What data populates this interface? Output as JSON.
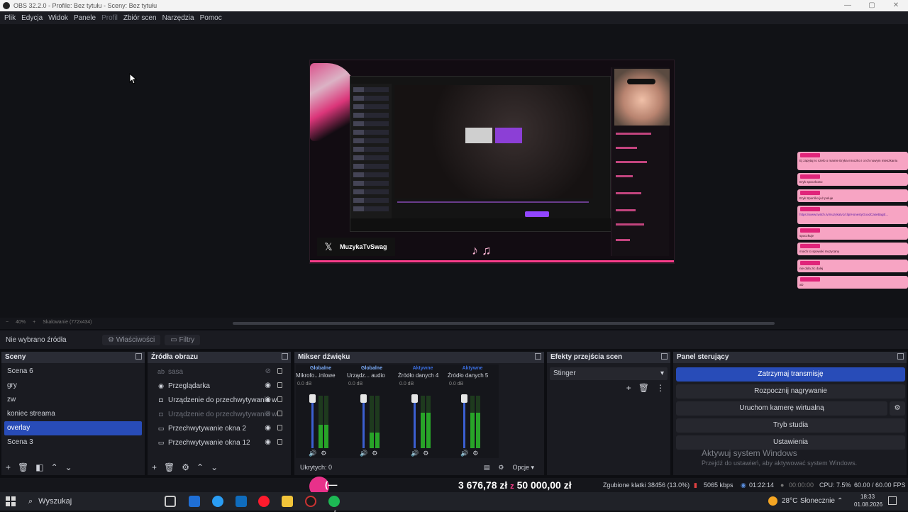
{
  "window": {
    "title": "OBS 32.2.0 - Profile: Bez tytułu - Sceny: Bez tytułu",
    "controls": [
      "—",
      "▢",
      "✕"
    ]
  },
  "menu": [
    "Plik",
    "Edycja",
    "Widok",
    "Panele",
    "Profil",
    "Zbiór scen",
    "Narzędzia",
    "Pomoc"
  ],
  "preview": {
    "stream_name": "MuzykaTvSwag",
    "zoom": "40%",
    "scaling": "Skalowanie (772x434)"
  },
  "chat_overlay": {
    "messages": [
      "Ej zapytaj ro szelo o mamie Eryka mroczko i o ich nowym mieszkaniu",
      "Eryk spoczkowo",
      "Eryk Sporriko już poluje",
      "https://www.twitch.tv/muzykatv1/clip/HonestyGoodCakeBagE...",
      "spoczkuje",
      "moich to spowoki muzycany",
      "nie dola zic dalej",
      "xD"
    ]
  },
  "source_toolbar": {
    "no_source": "Nie wybrano źródła",
    "properties": "Właściwości",
    "filters": "Filtry"
  },
  "scenes": {
    "title": "Sceny",
    "items": [
      "Scena 6",
      "gry",
      "zw",
      "koniec streama",
      "overlay",
      "Scena 3"
    ],
    "selected": "overlay"
  },
  "sources": {
    "title": "Źródła obrazu",
    "items": [
      {
        "label": "sasa",
        "icon": "text-icon",
        "visible": false
      },
      {
        "label": "Przeglądarka",
        "icon": "globe-icon",
        "visible": true
      },
      {
        "label": "Urządzenie do przechwytywania w",
        "icon": "camera-icon",
        "visible": true
      },
      {
        "label": "Urządzenie do przechwytywania w",
        "icon": "camera-icon",
        "visible": false
      },
      {
        "label": "Przechwytywanie okna 2",
        "icon": "window-icon",
        "visible": true
      },
      {
        "label": "Przechwytywanie okna 12",
        "icon": "window-icon",
        "visible": true
      }
    ]
  },
  "mixer": {
    "title": "Mikser dźwięku",
    "channels": [
      {
        "badge": "Globalne",
        "badge_color": "#4a8bff",
        "name": "Mikrofo...inlowe",
        "db": "0.0 dB",
        "level": 0.45
      },
      {
        "badge": "Globalne",
        "badge_color": "#4a8bff",
        "name": "Urządz... audio",
        "db": "0.0 dB",
        "level": 0.3
      },
      {
        "badge": "Aktywne",
        "badge_color": "#3b6ee0",
        "name": "Źródło danych 4",
        "db": "0.0 dB",
        "level": 0.68
      },
      {
        "badge": "Aktywne",
        "badge_color": "#3b6ee0",
        "name": "Źródło danych 5",
        "db": "0.0 dB",
        "level": 0.68
      }
    ],
    "scale": [
      "0",
      "-6",
      "-12",
      "-18",
      "-24",
      "-30",
      "-36",
      "-42",
      "-48",
      "-54",
      "-60"
    ],
    "hidden": "Ukrytych: 0",
    "options": "Opcje"
  },
  "transitions": {
    "title": "Efekty przejścia scen",
    "selected": "Stinger"
  },
  "controls": {
    "title": "Panel sterujący",
    "stop_stream": "Zatrzymaj transmisję",
    "start_recording": "Rozpocznij nagrywanie",
    "virtual_cam": "Uruchom kamerę wirtualną",
    "studio_mode": "Tryb studia",
    "settings": "Ustawienia"
  },
  "activation": {
    "title": "Aktywuj system Windows",
    "subtitle": "Przejdź do ustawień, aby aktywować system Windows."
  },
  "donation": {
    "face": "(—‿‿—)",
    "current": "3 676,78 zł",
    "separator": "z",
    "goal": "50 000,00 zł"
  },
  "status": {
    "dropped": "Zgubione klatki 38456 (13.0%)",
    "bitrate": "5065 kbps",
    "stream_time": "01:22:14",
    "rec_time": "00:00:00",
    "cpu": "CPU: 7.5%",
    "fps": "60.00 / 60.00 FPS"
  },
  "taskbar": {
    "search": "Wyszukaj",
    "weather": "28°C",
    "weather_text": "Słonecznie",
    "time": "18:33",
    "date": "01.08.2026"
  },
  "colors": {
    "accent": "#284cb8",
    "pink": "#ff3d8c"
  }
}
